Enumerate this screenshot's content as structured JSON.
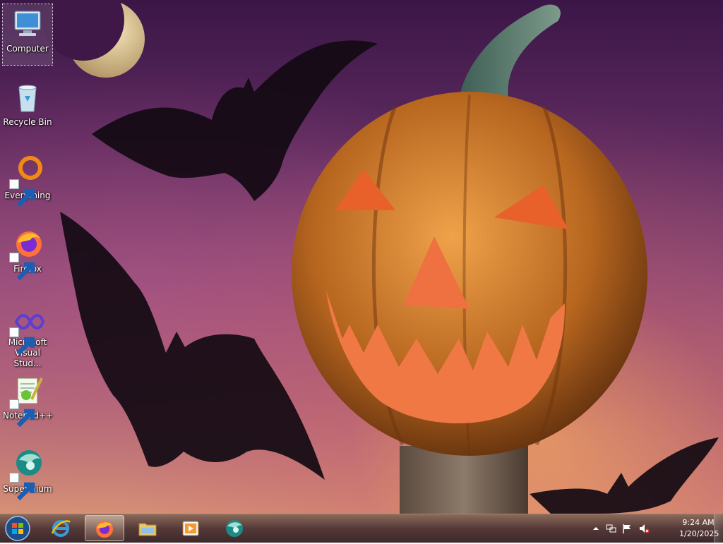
{
  "desktop": {
    "icons": [
      {
        "label": "Computer",
        "icon": "computer-icon",
        "selected": true
      },
      {
        "label": "Recycle Bin",
        "icon": "recycle-bin-icon"
      },
      {
        "label": "Everything",
        "icon": "everything-icon",
        "shortcut": true
      },
      {
        "label": "Firefox",
        "icon": "firefox-icon",
        "shortcut": true
      },
      {
        "label": "Microsoft Visual Stud...",
        "icon": "visual-studio-icon",
        "shortcut": true
      },
      {
        "label": "Notepad++",
        "icon": "notepadpp-icon",
        "shortcut": true
      },
      {
        "label": "Supermium",
        "icon": "supermium-icon",
        "shortcut": true
      }
    ]
  },
  "taskbar": {
    "pinned": [
      {
        "icon": "start-orb-icon"
      },
      {
        "icon": "internet-explorer-icon"
      },
      {
        "icon": "firefox-icon",
        "active": true
      },
      {
        "icon": "file-explorer-icon"
      },
      {
        "icon": "media-player-icon"
      },
      {
        "icon": "supermium-icon"
      }
    ],
    "tray": {
      "icons": [
        "show-hidden-icons-chevron",
        "network-icon",
        "action-center-flag-icon",
        "volume-muted-icon"
      ],
      "time": "9:24 AM",
      "date": "1/20/2025"
    }
  },
  "theme": {
    "sky_top": "#3b1646",
    "sky_bottom": "#d79474",
    "pumpkin": "#c8782a",
    "glow": "#ff8a3d"
  }
}
